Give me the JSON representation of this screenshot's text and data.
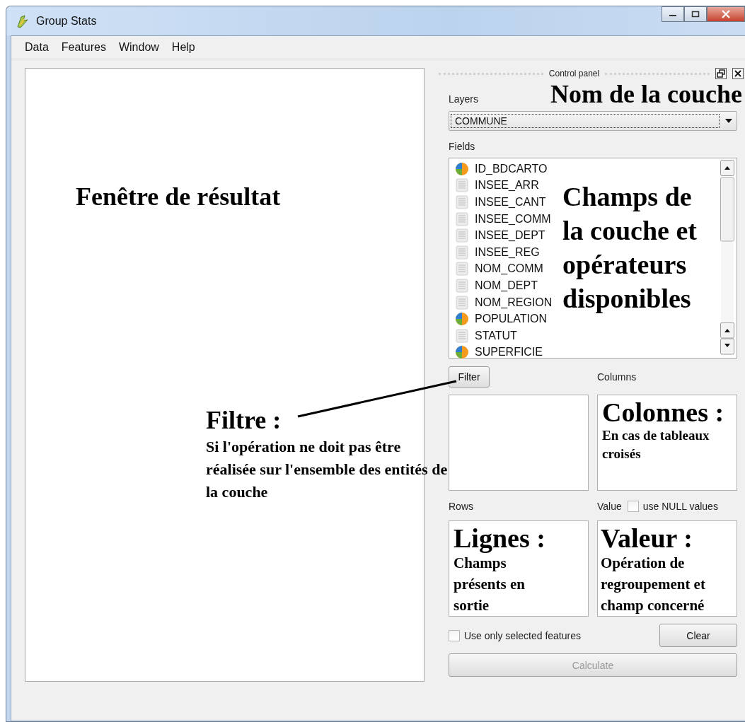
{
  "window": {
    "title": "Group Stats"
  },
  "menu": [
    "Data",
    "Features",
    "Window",
    "Help"
  ],
  "result_pane": {
    "annotation": "Fenêtre de résultat"
  },
  "control_panel": {
    "title": "Control panel",
    "layers_label": "Layers",
    "layer_value": "COMMUNE",
    "layer_annotation": "Nom de la couche",
    "fields_label": "Fields",
    "fields": [
      {
        "name": "ID_BDCARTO",
        "kind": "numeric"
      },
      {
        "name": "INSEE_ARR",
        "kind": "text"
      },
      {
        "name": "INSEE_CANT",
        "kind": "text"
      },
      {
        "name": "INSEE_COMM",
        "kind": "text"
      },
      {
        "name": "INSEE_DEPT",
        "kind": "text"
      },
      {
        "name": "INSEE_REG",
        "kind": "text"
      },
      {
        "name": "NOM_COMM",
        "kind": "text"
      },
      {
        "name": "NOM_DEPT",
        "kind": "text"
      },
      {
        "name": "NOM_REGION",
        "kind": "text"
      },
      {
        "name": "POPULATION",
        "kind": "numeric"
      },
      {
        "name": "STATUT",
        "kind": "text"
      },
      {
        "name": "SUPERFICIE",
        "kind": "numeric"
      }
    ],
    "fields_annotation": "Champs de la couche et opérateurs disponibles",
    "filter_button": "Filter",
    "filter_annotation": {
      "title": "Filtre :",
      "text": "Si l'opération ne doit pas être réalisée sur l'ensemble des entités de la couche"
    },
    "columns_label": "Columns",
    "columns_annotation": {
      "title": "Colonnes :",
      "text": "En cas de tableaux croisés"
    },
    "rows_label": "Rows",
    "value_label": "Value",
    "null_values": {
      "label": "use NULL values",
      "checked": false
    },
    "rows_annotation": {
      "title": "Lignes :",
      "text": "Champs présents en sortie"
    },
    "value_annotation": {
      "title": "Valeur :",
      "text": "Opération de regroupement et champ concerné"
    },
    "selected_only": {
      "label": "Use only selected features",
      "checked": false
    },
    "clear_button": "Clear",
    "calculate": {
      "label": "Calculate",
      "disabled": true
    }
  }
}
